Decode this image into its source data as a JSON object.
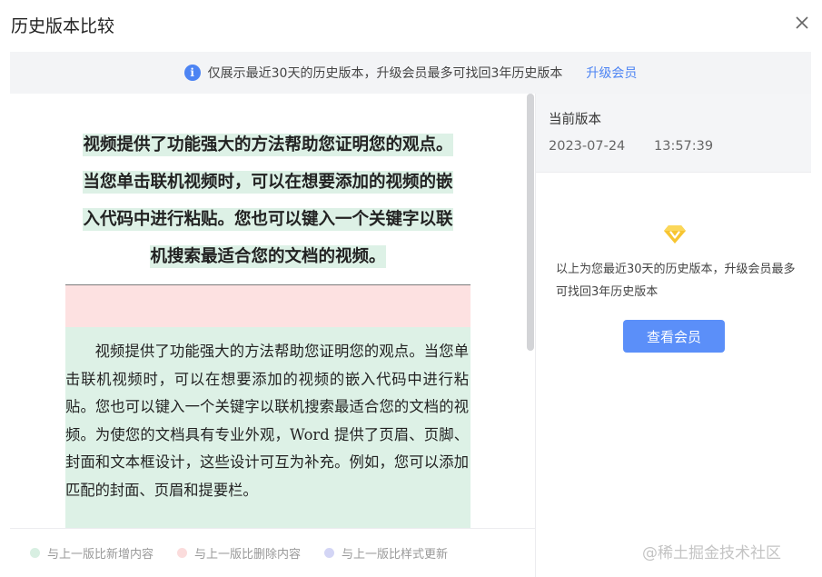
{
  "dialog": {
    "title": "历史版本比较",
    "close_icon": "close-icon"
  },
  "banner": {
    "info_glyph": "i",
    "message": "仅展示最近30天的历史版本，升级会员最多可找回3年历史版本",
    "link_label": "升级会员",
    "accent_color": "#4d84f3"
  },
  "document": {
    "heading_lines": [
      "视频提供了功能强大的方法帮助您证明您的观点。",
      "当您单击联机视频时，可以在想要添加的视频的嵌",
      "入代码中进行粘贴。您也可以键入一个关键字以联",
      "机搜索最适合您的文档的视频。"
    ],
    "body_text": "视频提供了功能强大的方法帮助您证明您的观点。当您单击联机视频时，可以在想要添加的视频的嵌入代码中进行粘贴。您也可以键入一个关键字以联机搜索最适合您的文档的视频。为使您的文档具有专业外观，Word 提供了页眉、页脚、封面和文本框设计，这些设计可互为补充。例如，您可以添加匹配的封面、页眉和提要栏。"
  },
  "legend": [
    {
      "label": "与上一版比新增内容",
      "color": "#d8efe2"
    },
    {
      "label": "与上一版比删除内容",
      "color": "#fbdcdc"
    },
    {
      "label": "与上一版比样式更新",
      "color": "#d3d5f5"
    }
  ],
  "current_version": {
    "label": "当前版本",
    "date": "2023-07-24",
    "time": "13:57:39"
  },
  "upsell": {
    "icon": "diamond-icon",
    "note": "以上为您最近30天的历史版本，升级会员最多可找回3年历史版本",
    "button_label": "查看会员",
    "button_color": "#5b8ff9"
  },
  "watermark": "@稀土掘金技术社区"
}
